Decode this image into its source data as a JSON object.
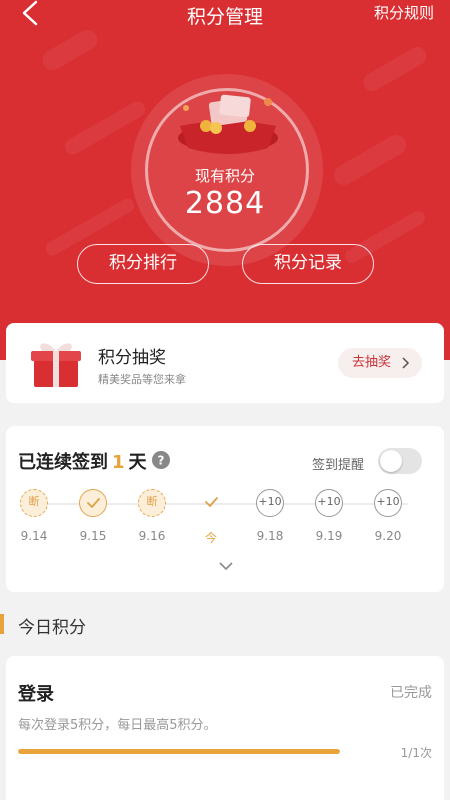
{
  "nav": {
    "title": "积分管理",
    "rules_link": "积分规则"
  },
  "summary": {
    "label": "现有积分",
    "points": "2884"
  },
  "buttons": {
    "ranking": "积分排行",
    "records": "积分记录"
  },
  "lottery": {
    "title": "积分抽奖",
    "subtitle": "精美奖品等您来拿",
    "action": "去抽奖"
  },
  "signin": {
    "streak_prefix": "已连续签到",
    "streak_days": "1",
    "streak_suffix": "天",
    "reminder_label": "签到提醒",
    "reminder_on": false,
    "days": [
      {
        "date": "9.14",
        "state": "broken",
        "mark": "断"
      },
      {
        "date": "9.15",
        "state": "done",
        "mark": ""
      },
      {
        "date": "9.16",
        "state": "broken",
        "mark": "断"
      },
      {
        "date": "今",
        "state": "today",
        "mark": ""
      },
      {
        "date": "9.18",
        "state": "future",
        "mark": "+10"
      },
      {
        "date": "9.19",
        "state": "future",
        "mark": "+10"
      },
      {
        "date": "9.20",
        "state": "future",
        "mark": "+10"
      }
    ]
  },
  "today_section": {
    "title": "今日积分"
  },
  "tasks": [
    {
      "title": "登录",
      "status": "已完成",
      "desc": "每次登录5积分，每日最高5积分。",
      "count": "1/1次",
      "progress": 1.0
    }
  ],
  "colors": {
    "brand_red": "#d92f33",
    "accent_gold": "#e8a33a"
  }
}
